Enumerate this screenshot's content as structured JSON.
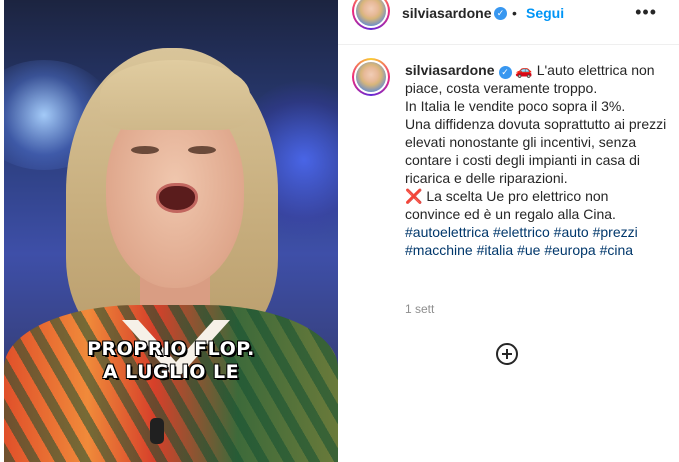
{
  "video": {
    "caption_lines": [
      "PROPRIO FLOP.",
      "A LUGLIO LE"
    ]
  },
  "header": {
    "username": "silviasardone",
    "verified_icon": "verified-badge-icon",
    "separator": "•",
    "follow_label": "Segui",
    "more_label": "•••"
  },
  "post": {
    "username": "silviasardone",
    "car_emoji": "🚗",
    "x_emoji": "❌",
    "caption_lines": [
      "L'auto elettrica non piace, costa veramente troppo.",
      "In Italia le vendite poco sopra il 3%.",
      "Una diffidenza dovuta soprattutto ai prezzi elevati nonostante gli incentivi, senza contare i costi degli impianti in casa di ricarica e delle riparazioni."
    ],
    "caption_second": "La scelta Ue pro elettrico non convince ed è un regalo alla Cina.",
    "hashtags": [
      "#autoelettrica",
      "#elettrico",
      "#auto",
      "#prezzi",
      "#macchine",
      "#italia",
      "#ue",
      "#europa",
      "#cina"
    ],
    "time": "1 sett",
    "add_comment_icon": "add-circle-icon"
  },
  "colors": {
    "link_blue": "#0095f6",
    "hashtag": "#00376b",
    "verified": "#3897f0",
    "meta_gray": "#8e8e8e"
  }
}
